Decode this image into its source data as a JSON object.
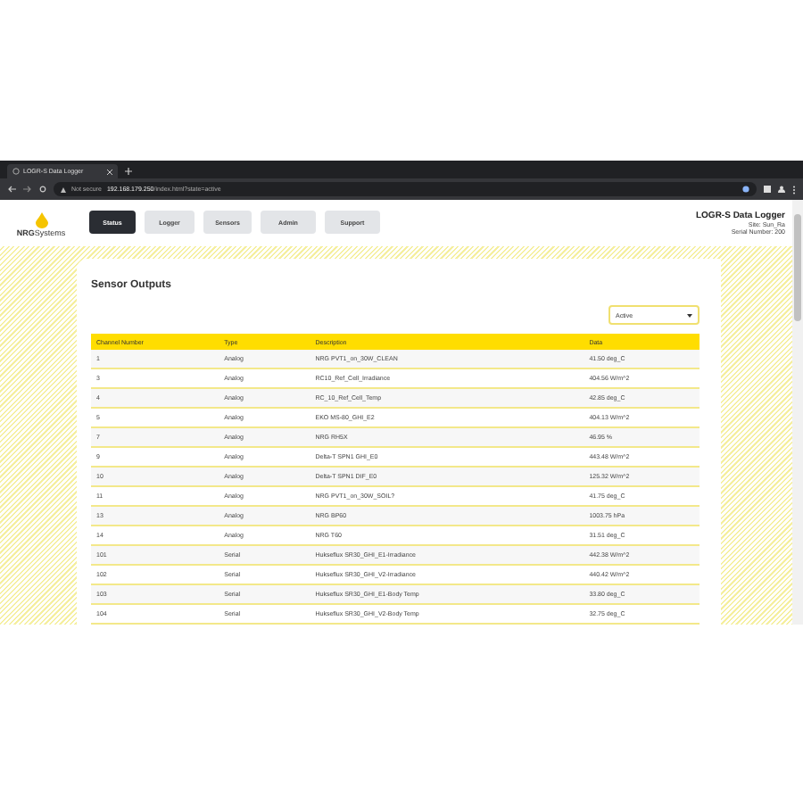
{
  "browser": {
    "tab_title": "LOGR-S Data Logger",
    "security": "Not secure",
    "url_host": "192.168.179.250",
    "url_path": "/index.html?state=active"
  },
  "logo": "**NRG**Systems",
  "nav": [
    {
      "label": "Status",
      "selected": true
    },
    {
      "label": "Logger",
      "selected": false
    },
    {
      "label": "Sensors",
      "selected": false
    },
    {
      "label": "Admin",
      "selected": false
    },
    {
      "label": "Support",
      "selected": false
    }
  ],
  "device": {
    "title": "LOGR-S Data Logger",
    "site": "Site: Sun_Ra",
    "serial": "Serial Number: 200"
  },
  "panel": {
    "title": "Sensor Outputs",
    "filter": "Active"
  },
  "table": {
    "columns": [
      "Channel Number",
      "Type",
      "Description",
      "Data"
    ],
    "rows": [
      [
        "1",
        "Analog",
        "NRG PVT1_on_30W_CLEAN",
        "41.50 deg_C"
      ],
      [
        "3",
        "Analog",
        "RC10_Ref_Cell_Irradiance",
        "404.56 W/m^2"
      ],
      [
        "4",
        "Analog",
        "RC_10_Ref_Cell_Temp",
        "42.85 deg_C"
      ],
      [
        "5",
        "Analog",
        "EKO MS-80_GHI_E2",
        "404.13 W/m^2"
      ],
      [
        "7",
        "Analog",
        "NRG RH5X",
        "46.95 %"
      ],
      [
        "9",
        "Analog",
        "Delta-T SPN1 GHI_E0",
        "443.48 W/m^2"
      ],
      [
        "10",
        "Analog",
        "Delta-T SPN1 DIF_E0",
        "125.32 W/m^2"
      ],
      [
        "11",
        "Analog",
        "NRG PVT1_on_30W_SOIL?",
        "41.75 deg_C"
      ],
      [
        "13",
        "Analog",
        "NRG BP60",
        "1003.75 hPa"
      ],
      [
        "14",
        "Analog",
        "NRG T60",
        "31.51 deg_C"
      ],
      [
        "101",
        "Serial",
        "Hukseflux SR30_GHI_E1-Irradiance",
        "442.38 W/m^2"
      ],
      [
        "102",
        "Serial",
        "Hukseflux SR30_GHI_V2-Irradiance",
        "440.42 W/m^2"
      ],
      [
        "103",
        "Serial",
        "Hukseflux SR30_GHI_E1-Body Temp",
        "33.80 deg_C"
      ],
      [
        "104",
        "Serial",
        "Hukseflux SR30_GHI_V2-Body Temp",
        "32.75 deg_C"
      ]
    ]
  }
}
